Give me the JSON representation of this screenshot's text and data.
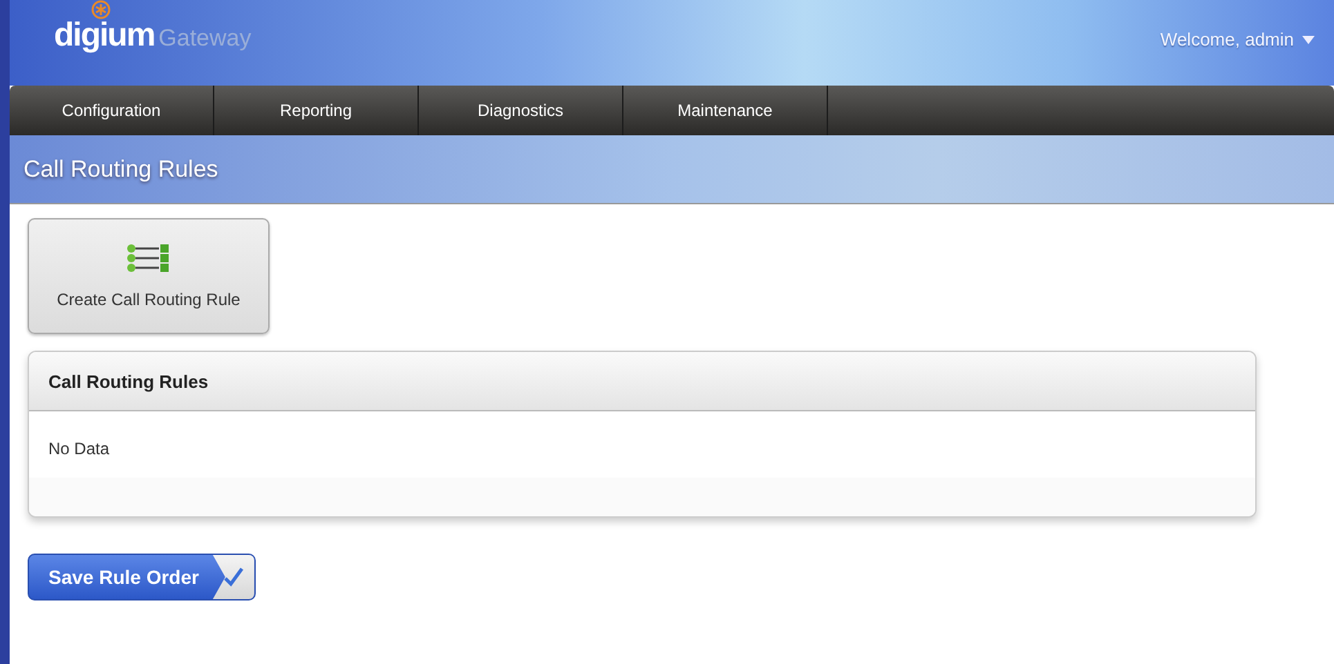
{
  "header": {
    "logo": "digium",
    "product": "Gateway",
    "user_menu": "Welcome, admin"
  },
  "nav": [
    {
      "label": "Configuration"
    },
    {
      "label": "Reporting"
    },
    {
      "label": "Diagnostics"
    },
    {
      "label": "Maintenance"
    }
  ],
  "page_title": "Call Routing Rules",
  "create_button": "Create Call Routing Rule",
  "panel": {
    "title": "Call Routing Rules",
    "empty_text": "No Data"
  },
  "save_button": "Save Rule Order"
}
